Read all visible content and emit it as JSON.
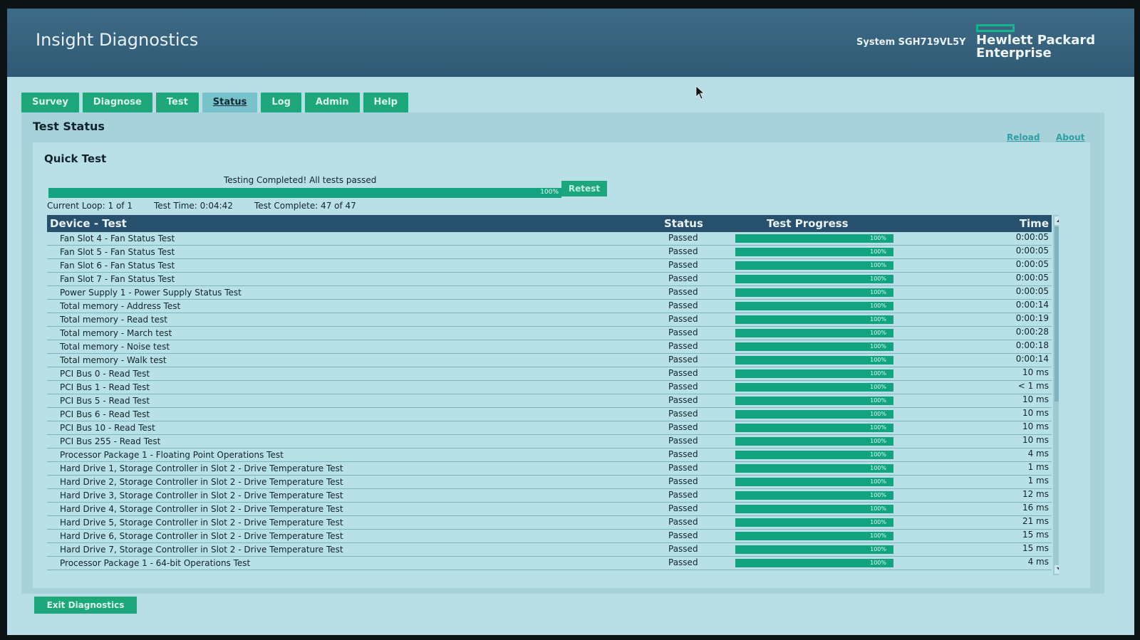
{
  "header": {
    "app_title": "Insight Diagnostics",
    "system_id": "System SGH719VL5Y",
    "logo_text": "Hewlett Packard\nEnterprise"
  },
  "tabs": [
    {
      "label": "Survey"
    },
    {
      "label": "Diagnose"
    },
    {
      "label": "Test"
    },
    {
      "label": "Status",
      "active": true
    },
    {
      "label": "Log"
    },
    {
      "label": "Admin"
    },
    {
      "label": "Help"
    }
  ],
  "page": {
    "section_title": "Test Status",
    "reload": "Reload",
    "about": "About"
  },
  "quick_test": {
    "title": "Quick Test",
    "message": "Testing Completed! All tests passed",
    "progress_label": "100%",
    "progress_value": 1.0,
    "retest": "Retest",
    "current_loop": "Current Loop: 1 of 1",
    "test_time": "Test Time: 0:04:42",
    "test_complete": "Test Complete: 47 of 47"
  },
  "table": {
    "headers": {
      "test": "Device - Test",
      "status": "Status",
      "progress": "Test Progress",
      "time": "Time"
    },
    "rows": [
      {
        "test": "Fan Slot 4 - Fan Status Test",
        "status": "Passed",
        "progress": "100%",
        "time": "0:00:05"
      },
      {
        "test": "Fan Slot 5 - Fan Status Test",
        "status": "Passed",
        "progress": "100%",
        "time": "0:00:05"
      },
      {
        "test": "Fan Slot 6 - Fan Status Test",
        "status": "Passed",
        "progress": "100%",
        "time": "0:00:05"
      },
      {
        "test": "Fan Slot 7 - Fan Status Test",
        "status": "Passed",
        "progress": "100%",
        "time": "0:00:05"
      },
      {
        "test": "Power Supply 1 - Power Supply Status Test",
        "status": "Passed",
        "progress": "100%",
        "time": "0:00:05"
      },
      {
        "test": "Total memory - Address Test",
        "status": "Passed",
        "progress": "100%",
        "time": "0:00:14"
      },
      {
        "test": "Total memory - Read test",
        "status": "Passed",
        "progress": "100%",
        "time": "0:00:19"
      },
      {
        "test": "Total memory - March test",
        "status": "Passed",
        "progress": "100%",
        "time": "0:00:28"
      },
      {
        "test": "Total memory - Noise test",
        "status": "Passed",
        "progress": "100%",
        "time": "0:00:18"
      },
      {
        "test": "Total memory - Walk test",
        "status": "Passed",
        "progress": "100%",
        "time": "0:00:14"
      },
      {
        "test": "PCI Bus 0 - Read Test",
        "status": "Passed",
        "progress": "100%",
        "time": "10 ms"
      },
      {
        "test": "PCI Bus 1 - Read Test",
        "status": "Passed",
        "progress": "100%",
        "time": "< 1 ms"
      },
      {
        "test": "PCI Bus 5 - Read Test",
        "status": "Passed",
        "progress": "100%",
        "time": "10 ms"
      },
      {
        "test": "PCI Bus 6 - Read Test",
        "status": "Passed",
        "progress": "100%",
        "time": "10 ms"
      },
      {
        "test": "PCI Bus 10 - Read Test",
        "status": "Passed",
        "progress": "100%",
        "time": "10 ms"
      },
      {
        "test": "PCI Bus 255 - Read Test",
        "status": "Passed",
        "progress": "100%",
        "time": "10 ms"
      },
      {
        "test": "Processor Package 1 - Floating Point Operations Test",
        "status": "Passed",
        "progress": "100%",
        "time": "4 ms"
      },
      {
        "test": "Hard Drive 1, Storage Controller in Slot 2 - Drive Temperature Test",
        "status": "Passed",
        "progress": "100%",
        "time": "1 ms"
      },
      {
        "test": "Hard Drive 2, Storage Controller in Slot 2 - Drive Temperature Test",
        "status": "Passed",
        "progress": "100%",
        "time": "1 ms"
      },
      {
        "test": "Hard Drive 3, Storage Controller in Slot 2 - Drive Temperature Test",
        "status": "Passed",
        "progress": "100%",
        "time": "12 ms"
      },
      {
        "test": "Hard Drive 4, Storage Controller in Slot 2 - Drive Temperature Test",
        "status": "Passed",
        "progress": "100%",
        "time": "16 ms"
      },
      {
        "test": "Hard Drive 5, Storage Controller in Slot 2 - Drive Temperature Test",
        "status": "Passed",
        "progress": "100%",
        "time": "21 ms"
      },
      {
        "test": "Hard Drive 6, Storage Controller in Slot 2 - Drive Temperature Test",
        "status": "Passed",
        "progress": "100%",
        "time": "15 ms"
      },
      {
        "test": "Hard Drive 7, Storage Controller in Slot 2 - Drive Temperature Test",
        "status": "Passed",
        "progress": "100%",
        "time": "15 ms"
      },
      {
        "test": "Processor Package 1 - 64-bit Operations Test",
        "status": "Passed",
        "progress": "100%",
        "time": "4 ms"
      }
    ]
  },
  "footer": {
    "exit": "Exit Diagnostics"
  },
  "colors": {
    "header_bg": "#2f5a75",
    "accent_green": "#1fa77c",
    "table_header_bg": "#27506c",
    "panel_bg": "#b9e0e7"
  }
}
